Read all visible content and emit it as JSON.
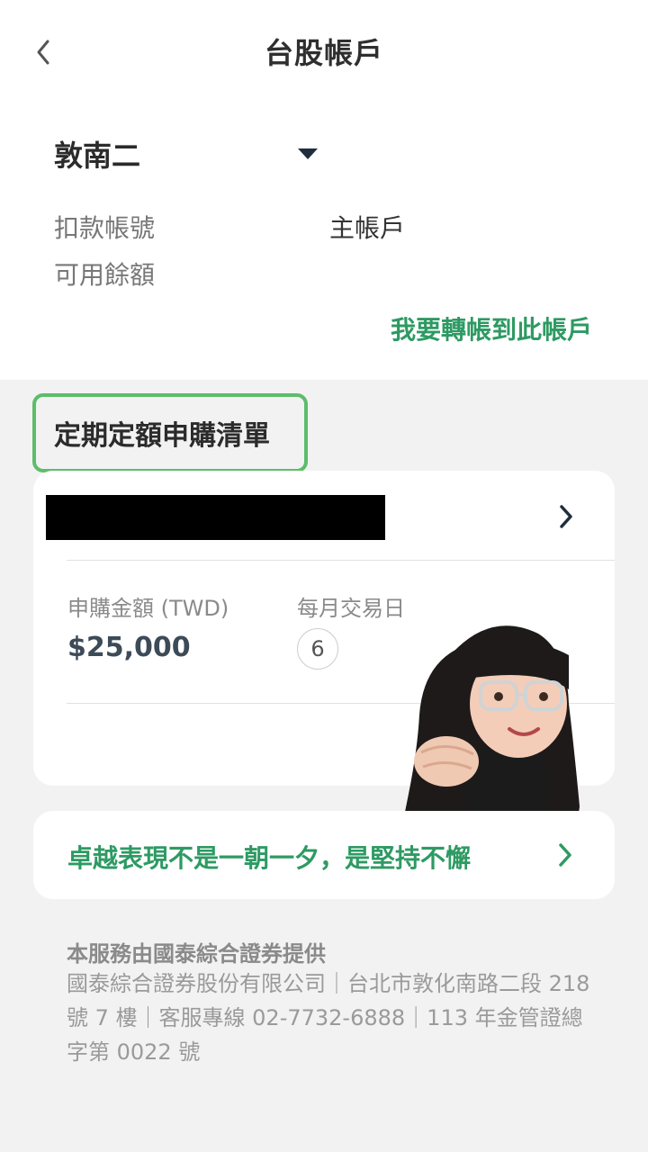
{
  "header": {
    "title": "台股帳戶"
  },
  "account": {
    "branch": "敦南二",
    "debit_label": "扣款帳號",
    "debit_value": "主帳戶",
    "balance_label": "可用餘額",
    "transfer_link": "我要轉帳到此帳戶"
  },
  "section": {
    "title": "定期定額申購清單"
  },
  "plan": {
    "amount_label": "申購金額 (TWD)",
    "amount_value": "$25,000",
    "day_label": "每月交易日",
    "day_value": "6"
  },
  "promo": {
    "text": "卓越表現不是一朝一夕，是堅持不懈"
  },
  "footer": {
    "title": "本服務由國泰綜合證券提供",
    "body": "國泰綜合證券股份有限公司｜台北市敦化南路二段 218 號 7 樓｜客服專線 02-7732-6888｜113 年金管證總字第 0022 號"
  },
  "colors": {
    "accent_green": "#2e9a63",
    "highlight_green": "#5dbd6a",
    "chevron_navy": "#1f2e3d"
  },
  "icons": {
    "back": "chevron-left-icon",
    "dropdown": "caret-down-icon",
    "card_open": "chevron-right-icon",
    "promo_open": "chevron-right-icon"
  }
}
